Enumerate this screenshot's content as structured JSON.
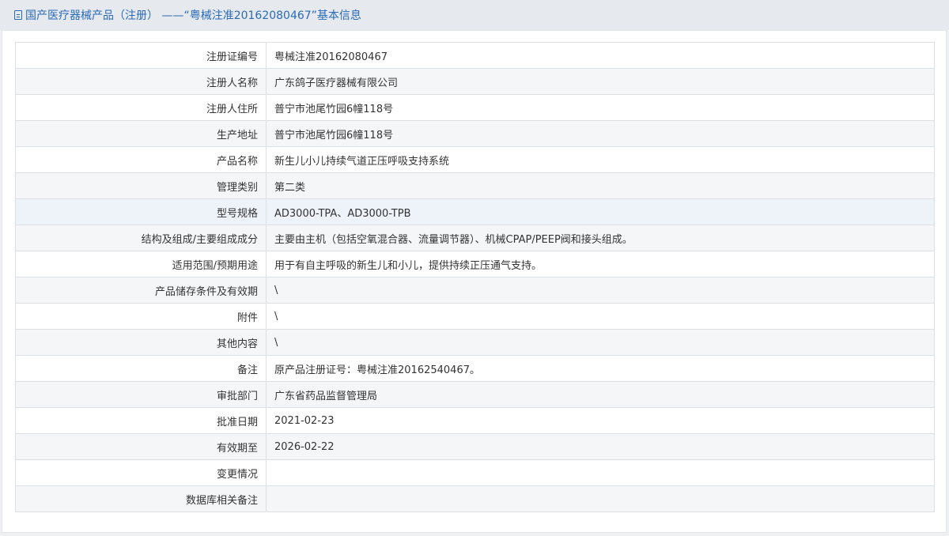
{
  "header": {
    "title": "国产医疗器械产品（注册） ——“粤械注准20162080467”基本信息"
  },
  "rows": [
    {
      "label": "注册证编号",
      "value": "粤械注准20162080467"
    },
    {
      "label": "注册人名称",
      "value": "广东鸽子医疗器械有限公司"
    },
    {
      "label": "注册人住所",
      "value": "普宁市池尾竹园6幢118号"
    },
    {
      "label": "生产地址",
      "value": "普宁市池尾竹园6幢118号"
    },
    {
      "label": "产品名称",
      "value": "新生儿小儿持续气道正压呼吸支持系统"
    },
    {
      "label": "管理类别",
      "value": "第二类"
    },
    {
      "label": "型号规格",
      "value": "AD3000-TPA、AD3000-TPB"
    },
    {
      "label": "结构及组成/主要组成成分",
      "value": "主要由主机（包括空氧混合器、流量调节器）、机械CPAP/PEEP阀和接头组成。"
    },
    {
      "label": "适用范围/预期用途",
      "value": "用于有自主呼吸的新生儿和小儿，提供持续正压通气支持。"
    },
    {
      "label": "产品储存条件及有效期",
      "value": "\\"
    },
    {
      "label": "附件",
      "value": "\\"
    },
    {
      "label": "其他内容",
      "value": "\\"
    },
    {
      "label": "备注",
      "value": "原产品注册证号：粤械注准20162540467。"
    },
    {
      "label": "审批部门",
      "value": "广东省药品监督管理局"
    },
    {
      "label": "批准日期",
      "value": "2021-02-23"
    },
    {
      "label": "有效期至",
      "value": "2026-02-22"
    },
    {
      "label": "变更情况",
      "value": ""
    },
    {
      "label": "数据库相关备注",
      "value": ""
    }
  ],
  "icons": {
    "header": "document-icon"
  }
}
